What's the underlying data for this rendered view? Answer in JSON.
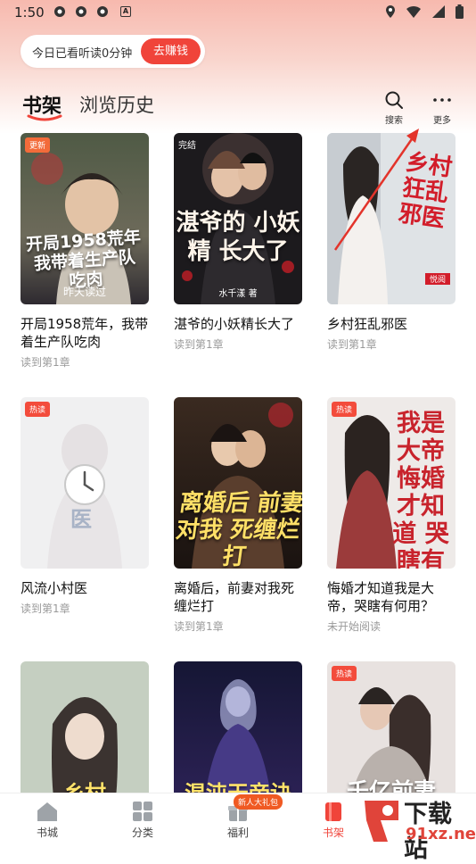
{
  "status_bar": {
    "time": "1:50",
    "a_icon": "A"
  },
  "promo": {
    "text": "今日已看听读0分钟",
    "button": "去赚钱"
  },
  "tabs": {
    "shelf": "书架",
    "history": "浏览历史"
  },
  "toolbar": {
    "search": "搜索",
    "more": "更多"
  },
  "books": [
    {
      "title": "开局1958荒年，我带着生产队吃肉",
      "progress": "读到第1章",
      "badge": "更新",
      "cover_text": "开局1958荒年 我带着生产队吃肉",
      "cover_note": "昨天读过"
    },
    {
      "title": "湛爷的小妖精长大了",
      "progress": "读到第1章",
      "badge": "完结",
      "cover_text": "湛爷的 小妖精 长大了",
      "cover_note": "水千漾 著"
    },
    {
      "title": "乡村狂乱邪医",
      "progress": "读到第1章",
      "badge": "",
      "cover_text": "乡村狂乱邪医",
      "cover_note": "悦阅"
    },
    {
      "title": "风流小村医",
      "progress": "读到第1章",
      "badge": "热读",
      "cover_text": "风 医",
      "cover_note": ""
    },
    {
      "title": "离婚后，前妻对我死缠烂打",
      "progress": "读到第1章",
      "badge": "",
      "cover_text": "离婚后 前妻对我 死缠烂打",
      "cover_note": ""
    },
    {
      "title": "悔婚才知道我是大帝，哭瞎有何用？",
      "progress": "未开始阅读",
      "badge": "热读",
      "cover_text": "我是大帝 悔婚才知道 哭瞎有何用？",
      "cover_note": ""
    },
    {
      "title": "",
      "progress": "",
      "badge": "",
      "cover_text": "乡村",
      "cover_note": ""
    },
    {
      "title": "",
      "progress": "",
      "badge": "",
      "cover_text": "混沌天帝诀",
      "cover_note": ""
    },
    {
      "title": "",
      "progress": "",
      "badge": "热读",
      "cover_text": "千亿前妻",
      "cover_note": ""
    }
  ],
  "nav": {
    "items": [
      "书城",
      "分类",
      "福利",
      "书架"
    ],
    "welfare_badge": "新人大礼包",
    "active": "书架"
  },
  "watermark": {
    "text": "下载站",
    "url": "91xz.net"
  },
  "colors": {
    "accent": "#f0443a"
  }
}
